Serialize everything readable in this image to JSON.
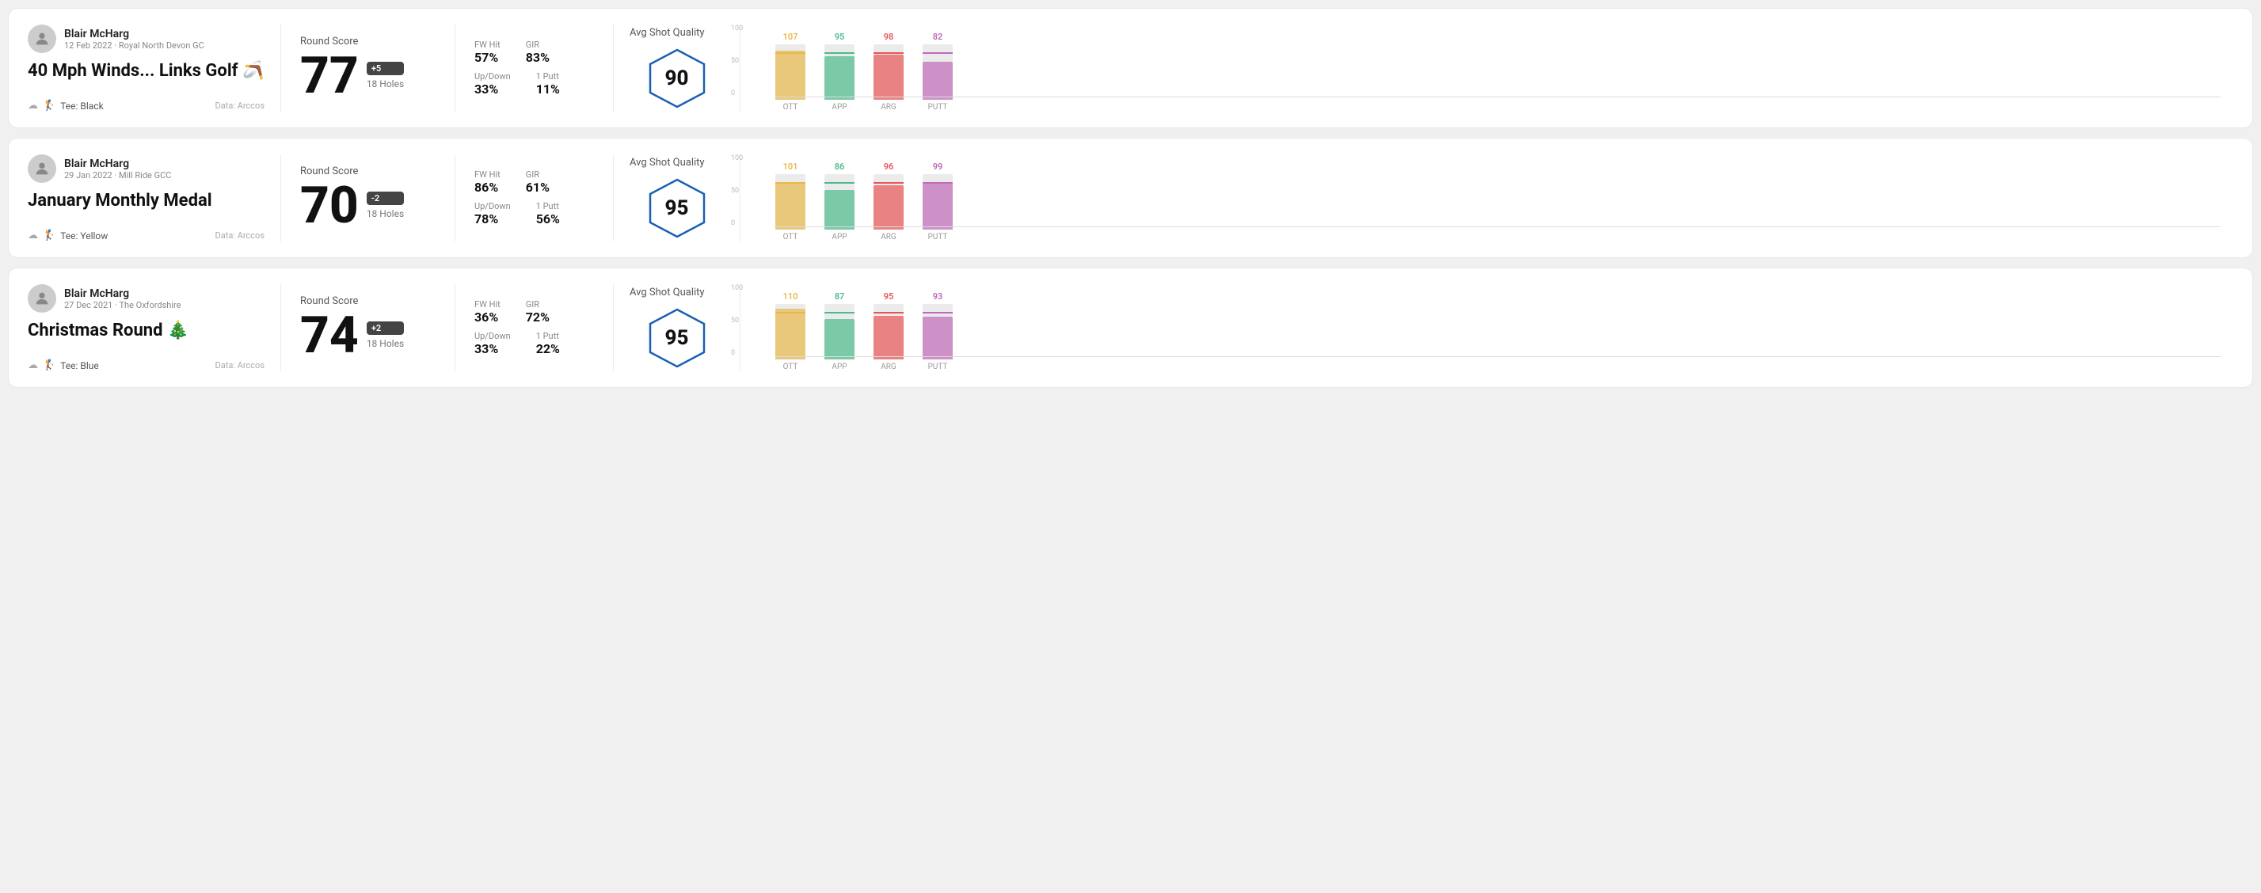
{
  "rounds": [
    {
      "id": "round1",
      "user": {
        "name": "Blair McHarg",
        "date": "12 Feb 2022",
        "course": "Royal North Devon GC"
      },
      "title": "40 Mph Winds... Links Golf 🪃",
      "tee": "Black",
      "data_source": "Data: Arccos",
      "score": {
        "value": "77",
        "modifier": "+5",
        "holes": "18 Holes"
      },
      "stats": {
        "fw_hit_label": "FW Hit",
        "fw_hit_value": "57%",
        "gir_label": "GIR",
        "gir_value": "83%",
        "updown_label": "Up/Down",
        "updown_value": "33%",
        "one_putt_label": "1 Putt",
        "one_putt_value": "11%"
      },
      "quality": {
        "label": "Avg Shot Quality",
        "value": "90"
      },
      "chart": {
        "bars": [
          {
            "label": "OTT",
            "value": 107,
            "max": 120,
            "color": "#e8b84b"
          },
          {
            "label": "APP",
            "value": 95,
            "max": 120,
            "color": "#4cbb8a"
          },
          {
            "label": "ARG",
            "value": 98,
            "max": 120,
            "color": "#e85555"
          },
          {
            "label": "PUTT",
            "value": 82,
            "max": 120,
            "color": "#c06bb8"
          }
        ],
        "y_labels": [
          "100",
          "50",
          "0"
        ]
      }
    },
    {
      "id": "round2",
      "user": {
        "name": "Blair McHarg",
        "date": "29 Jan 2022",
        "course": "Mill Ride GCC"
      },
      "title": "January Monthly Medal",
      "tee": "Yellow",
      "data_source": "Data: Arccos",
      "score": {
        "value": "70",
        "modifier": "-2",
        "holes": "18 Holes"
      },
      "stats": {
        "fw_hit_label": "FW Hit",
        "fw_hit_value": "86%",
        "gir_label": "GIR",
        "gir_value": "61%",
        "updown_label": "Up/Down",
        "updown_value": "78%",
        "one_putt_label": "1 Putt",
        "one_putt_value": "56%"
      },
      "quality": {
        "label": "Avg Shot Quality",
        "value": "95"
      },
      "chart": {
        "bars": [
          {
            "label": "OTT",
            "value": 101,
            "max": 120,
            "color": "#e8b84b"
          },
          {
            "label": "APP",
            "value": 86,
            "max": 120,
            "color": "#4cbb8a"
          },
          {
            "label": "ARG",
            "value": 96,
            "max": 120,
            "color": "#e85555"
          },
          {
            "label": "PUTT",
            "value": 99,
            "max": 120,
            "color": "#c06bb8"
          }
        ],
        "y_labels": [
          "100",
          "50",
          "0"
        ]
      }
    },
    {
      "id": "round3",
      "user": {
        "name": "Blair McHarg",
        "date": "27 Dec 2021",
        "course": "The Oxfordshire"
      },
      "title": "Christmas Round 🎄",
      "tee": "Blue",
      "data_source": "Data: Arccos",
      "score": {
        "value": "74",
        "modifier": "+2",
        "holes": "18 Holes"
      },
      "stats": {
        "fw_hit_label": "FW Hit",
        "fw_hit_value": "36%",
        "gir_label": "GIR",
        "gir_value": "72%",
        "updown_label": "Up/Down",
        "updown_value": "33%",
        "one_putt_label": "1 Putt",
        "one_putt_value": "22%"
      },
      "quality": {
        "label": "Avg Shot Quality",
        "value": "95"
      },
      "chart": {
        "bars": [
          {
            "label": "OTT",
            "value": 110,
            "max": 120,
            "color": "#e8b84b"
          },
          {
            "label": "APP",
            "value": 87,
            "max": 120,
            "color": "#4cbb8a"
          },
          {
            "label": "ARG",
            "value": 95,
            "max": 120,
            "color": "#e85555"
          },
          {
            "label": "PUTT",
            "value": 93,
            "max": 120,
            "color": "#c06bb8"
          }
        ],
        "y_labels": [
          "100",
          "50",
          "0"
        ]
      }
    }
  ]
}
